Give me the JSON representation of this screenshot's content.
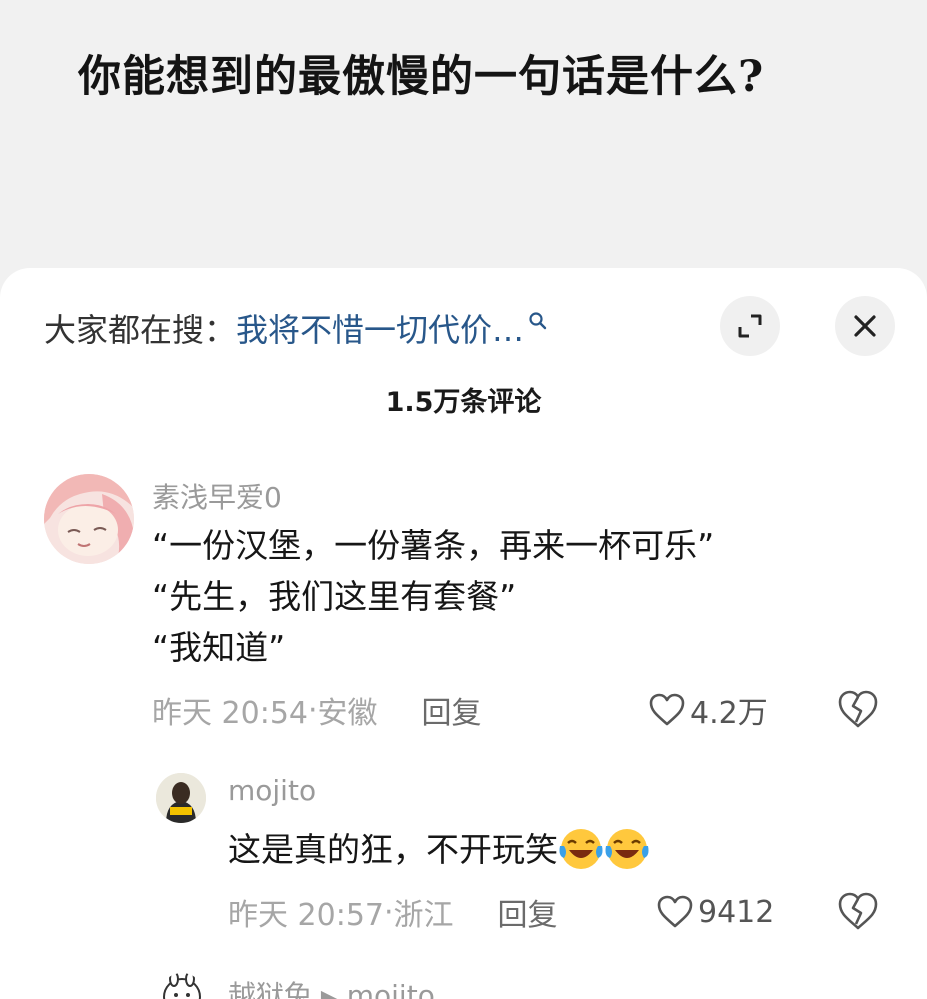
{
  "question": {
    "title": "你能想到的最傲慢的一句话是什么?"
  },
  "panel": {
    "search_prefix": "大家都在搜：",
    "search_term": "我将不惜一切代价…",
    "comment_count": "1.5万条评论"
  },
  "comments": [
    {
      "username": "素浅早爱0",
      "lines": [
        "“一份汉堡，一份薯条，再来一杯可乐”",
        "“先生，我们这里有套餐”",
        "“我知道”"
      ],
      "time": "昨天 20:54",
      "separator": " · ",
      "location": "安徽",
      "reply_label": "回复",
      "likes": "4.2万"
    }
  ],
  "replies": [
    {
      "username": "mojito",
      "text": "这是真的狂，不开玩笑",
      "emojis": [
        "laughing-crying-emoji",
        "laughing-crying-emoji"
      ],
      "time": "昨天 20:57",
      "separator": " · ",
      "location": "浙江",
      "reply_label": "回复",
      "likes": "9412"
    },
    {
      "username": "越狱兔",
      "reply_marker": "▶",
      "reply_to": "mojito"
    }
  ],
  "icons": {
    "search": "search-icon",
    "expand": "expand-icon",
    "close": "close-icon",
    "like": "heart-outline-icon",
    "dislike": "broken-heart-icon"
  },
  "colors": {
    "page_bg": "#f1f1f1",
    "sheet_bg": "#ffffff",
    "link_blue": "#28578a",
    "meta_gray": "#a6a6a6",
    "emoji_yellow": "#ffc83d",
    "emoji_tear": "#3aa0e8"
  }
}
